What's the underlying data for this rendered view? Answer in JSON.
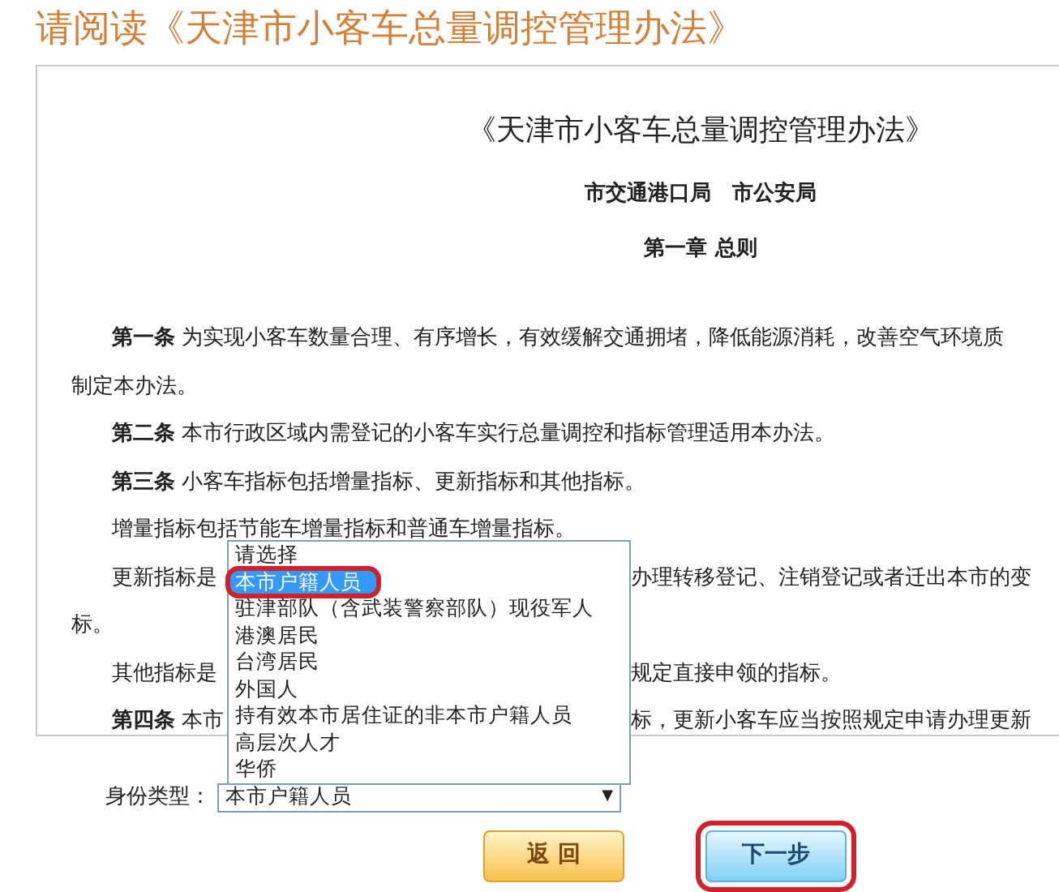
{
  "page_title": "请阅读《天津市小客车总量调控管理办法》",
  "document": {
    "title": "《天津市小客车总量调控管理办法》",
    "issuers": "市交通港口局　市公安局",
    "chapter": "第一章 总则",
    "lines": [
      {
        "kind": "para",
        "text": "**第一条** 为实现小客车数量合理、有序增长，有效缓解交通拥堵，降低能源消耗，改善空气环境质"
      },
      {
        "kind": "cont",
        "text": "制定本办法。"
      },
      {
        "kind": "para",
        "text": "**第二条** 本市行政区域内需登记的小客车实行总量调控和指标管理适用本办法。"
      },
      {
        "kind": "para",
        "text": "**第三条** 小客车指标包括增量指标、更新指标和其他指标。"
      },
      {
        "kind": "para",
        "text": "增量指标包括节能车增量指标和普通车增量指标。"
      },
      {
        "kind": "para",
        "text": "更新指标是",
        "after": "办理转移登记、注销登记或者迁出本市的变"
      },
      {
        "kind": "cont",
        "text": "标。"
      },
      {
        "kind": "para",
        "text": "其他指标是",
        "after": "规定直接申领的指标。"
      },
      {
        "kind": "para",
        "text": "**第四条** 本市",
        "after": "标，更新小客车应当按照规定申请办理更新"
      }
    ]
  },
  "identity_select": {
    "label": "身份类型：",
    "value": "本市户籍人员",
    "caret": "▼",
    "expanded": true,
    "options": [
      {
        "label": "请选择",
        "selected": false,
        "highlighted": false
      },
      {
        "label": "本市户籍人员",
        "selected": true,
        "highlighted": true
      },
      {
        "label": "驻津部队（含武装警察部队）现役军人",
        "selected": false,
        "highlighted": false
      },
      {
        "label": "港澳居民",
        "selected": false,
        "highlighted": false
      },
      {
        "label": "台湾居民",
        "selected": false,
        "highlighted": false
      },
      {
        "label": "外国人",
        "selected": false,
        "highlighted": false
      },
      {
        "label": "持有效本市居住证的非本市户籍人员",
        "selected": false,
        "highlighted": false
      },
      {
        "label": "高层次人才",
        "selected": false,
        "highlighted": false
      },
      {
        "label": "华侨",
        "selected": false,
        "highlighted": false
      }
    ]
  },
  "buttons": [
    {
      "kind": "back",
      "label": "返 回",
      "highlighted": false
    },
    {
      "kind": "next",
      "label": "下一步",
      "highlighted": true
    }
  ]
}
